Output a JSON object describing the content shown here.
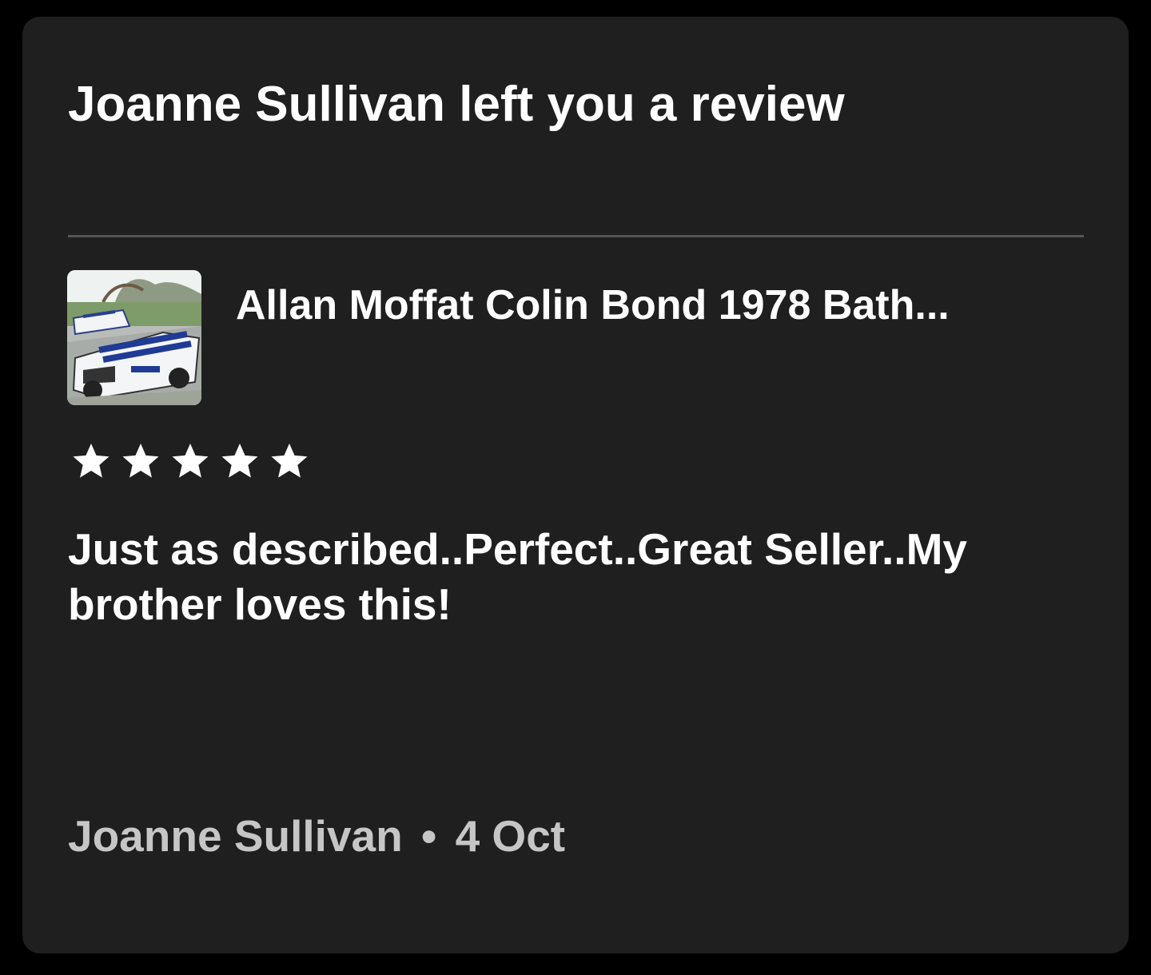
{
  "notification": {
    "title": "Joanne Sullivan left you a review",
    "listing": {
      "title": "Allan Moffat Colin Bond 1978 Bath..."
    },
    "rating": 5,
    "rating_max": 5,
    "review_text": "Just as described..Perfect..Great Seller..My brother loves this!",
    "reviewer": "Joanne Sullivan",
    "separator": "•",
    "date": "4 Oct"
  },
  "colors": {
    "card_background": "#1f1f1f",
    "page_background": "#000000",
    "primary_text": "#ffffff",
    "secondary_text": "#c6c6c6",
    "divider": "#555555",
    "star": "#ffffff"
  }
}
